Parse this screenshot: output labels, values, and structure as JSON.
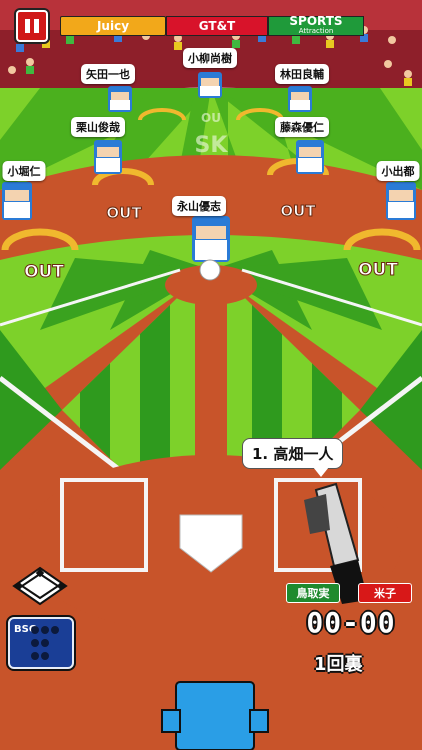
{
  "hud": {
    "pause_icon": "pause-icon",
    "ads": [
      {
        "text": "Juicy",
        "bg": "#f2a81a"
      },
      {
        "text": "GT&T",
        "bg": "#d8132a"
      },
      {
        "text": "SPORTS",
        "sub": "Attraction",
        "bg": "#1f9a3a"
      }
    ]
  },
  "fielders": [
    {
      "name": "小柳尚樹"
    },
    {
      "name": "矢田一也"
    },
    {
      "name": "林田良輔"
    },
    {
      "name": "栗山俊哉"
    },
    {
      "name": "藤森優仁"
    },
    {
      "name": "小堀仁"
    },
    {
      "name": "小出都"
    },
    {
      "name": "永山優志"
    }
  ],
  "field_text": {
    "out": "OUT"
  },
  "batter": {
    "label": "1. 高畑一人"
  },
  "scoreboard": {
    "away_team": "鳥取実",
    "home_team": "米子",
    "score": "00-00",
    "inning": "1回裏"
  },
  "controls": {
    "bso_label": "BSO",
    "bso_icon": "bso-indicator-icon",
    "diamond_icon": "base-diamond-icon"
  },
  "colors": {
    "dirt": "#c8542a",
    "grass_light": "#7dd12a",
    "grass_dark": "#2f9a1e",
    "uniform": "#2a7bd6",
    "away_team": "#1f8a2e",
    "home_team": "#d81818"
  }
}
